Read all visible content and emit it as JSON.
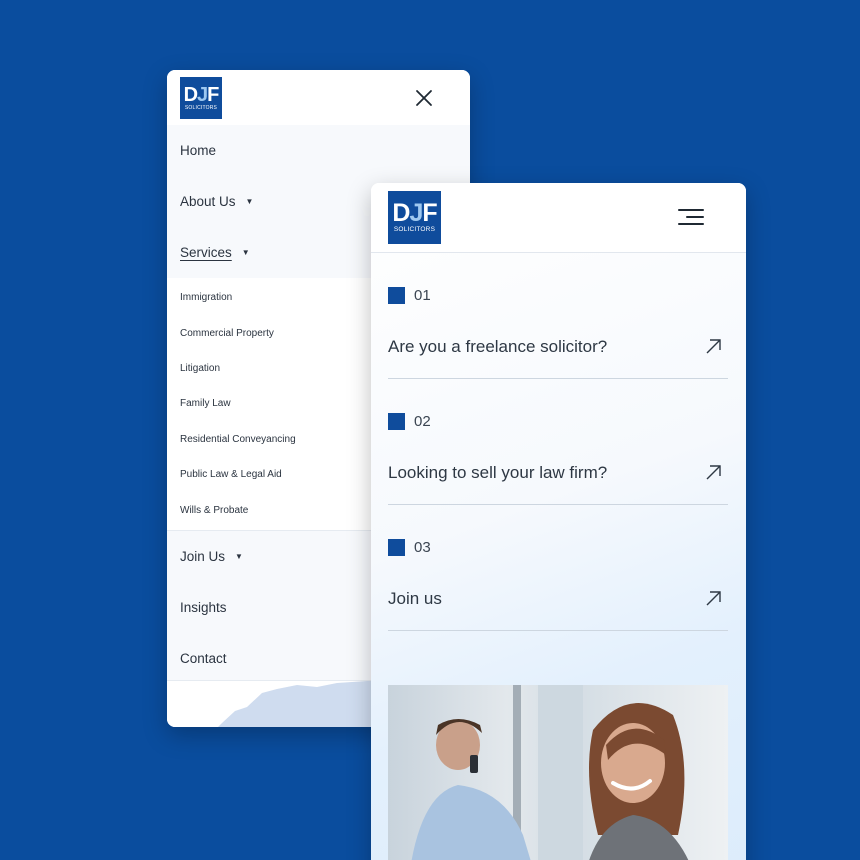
{
  "brand": {
    "logo_mark_d": "D",
    "logo_mark_j": "J",
    "logo_mark_f": "F",
    "logo_sub": "SOLICITORS",
    "primary_color": "#0f4c9c",
    "background_color": "#0a4d9e"
  },
  "menu": {
    "close_icon": "close-icon",
    "items": [
      {
        "label": "Home",
        "has_dropdown": false
      },
      {
        "label": "About Us",
        "has_dropdown": true
      },
      {
        "label": "Services",
        "has_dropdown": true,
        "active": true
      }
    ],
    "services": [
      "Immigration",
      "Commercial Property",
      "Litigation",
      "Family Law",
      "Residential Conveyancing",
      "Public Law & Legal Aid",
      "Wills & Probate"
    ],
    "items_after": [
      {
        "label": "Join Us",
        "has_dropdown": true
      },
      {
        "label": "Insights",
        "has_dropdown": false
      },
      {
        "label": "Contact",
        "has_dropdown": false
      }
    ]
  },
  "page": {
    "menu_icon": "hamburger-icon",
    "ctas": [
      {
        "number": "01",
        "title": "Are you a freelance solicitor?"
      },
      {
        "number": "02",
        "title": "Looking to sell your law firm?"
      },
      {
        "number": "03",
        "title": "Join us"
      }
    ]
  }
}
